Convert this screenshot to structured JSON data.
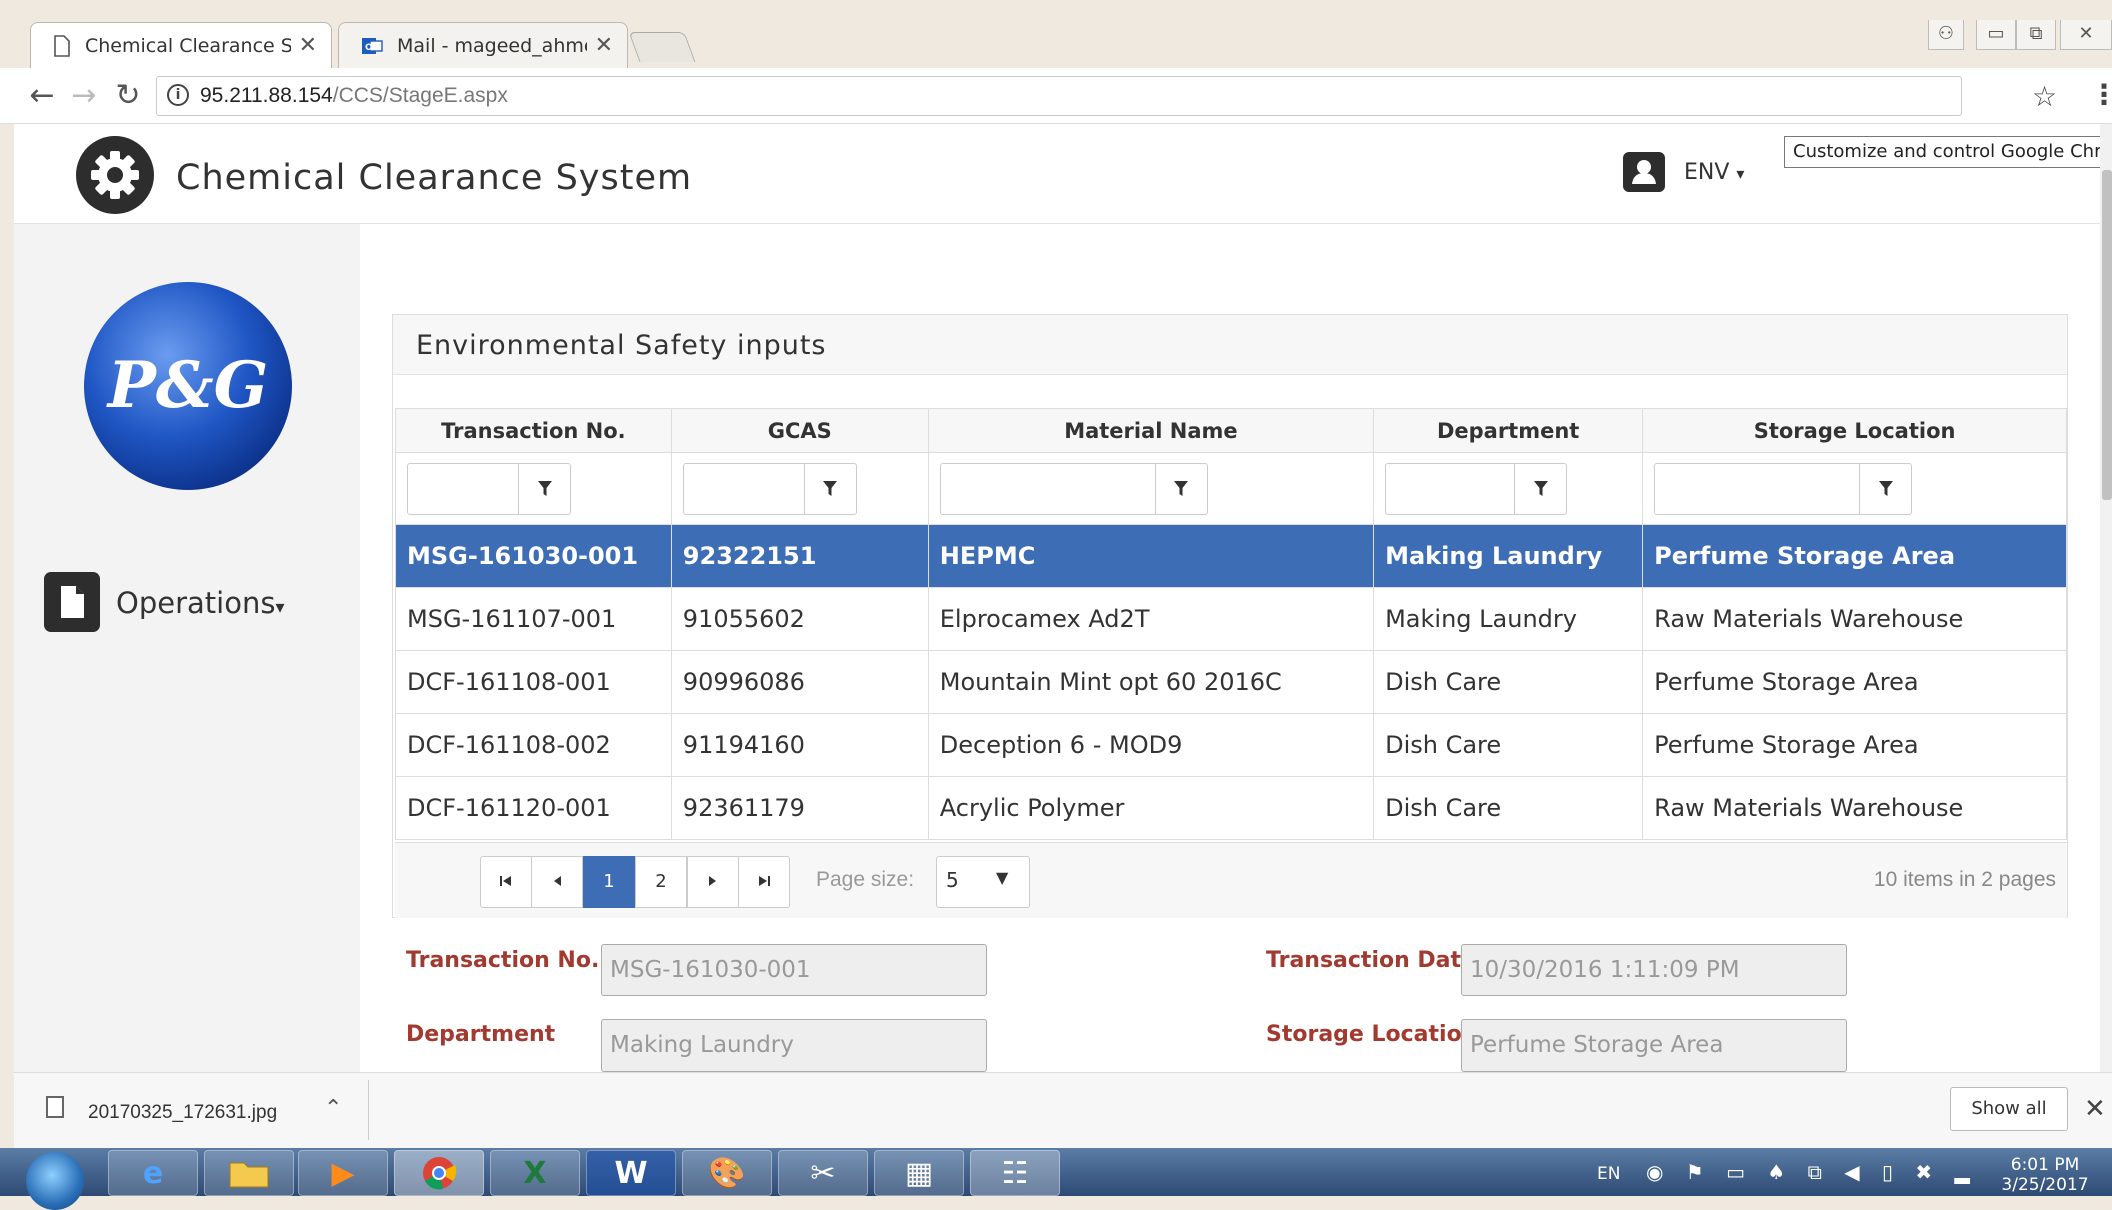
{
  "browser": {
    "tabs": [
      {
        "title": "Chemical Clearance Syst"
      },
      {
        "title": "Mail - mageed_ahmed@"
      }
    ],
    "url_host": "95.211.88.154",
    "url_path": "/CCS/StageE.aspx",
    "tooltip": "Customize and control Google Chrome"
  },
  "header": {
    "app_title": "Chemical Clearance System",
    "user_menu": "ENV",
    "caret": "▾"
  },
  "sidebar": {
    "logo_text": "P&G",
    "menu_label": "Operations"
  },
  "panel": {
    "title": "Environmental Safety inputs",
    "columns": [
      "Transaction No.",
      "GCAS",
      "Material Name",
      "Department",
      "Storage Location"
    ],
    "rows": [
      [
        "MSG-161030-001",
        "92322151",
        "HEPMC",
        "Making Laundry",
        "Perfume Storage Area"
      ],
      [
        "MSG-161107-001",
        "91055602",
        "Elprocamex Ad2T",
        "Making Laundry",
        "Raw Materials Warehouse"
      ],
      [
        "DCF-161108-001",
        "90996086",
        "Mountain Mint opt 60 2016C",
        "Dish Care",
        "Perfume Storage Area"
      ],
      [
        "DCF-161108-002",
        "91194160",
        "Deception 6 - MOD9",
        "Dish Care",
        "Perfume Storage Area"
      ],
      [
        "DCF-161120-001",
        "92361179",
        "Acrylic Polymer",
        "Dish Care",
        "Raw Materials Warehouse"
      ]
    ],
    "selected_row": 0,
    "pager": {
      "first": "⏮",
      "prev": "◀",
      "pages": [
        "1",
        "2"
      ],
      "current_page": "1",
      "next": "▶",
      "last": "⏭",
      "page_size_label": "Page size:",
      "page_size": "5",
      "info": "10 items in 2 pages"
    }
  },
  "form": {
    "transaction_no_label": "Transaction No.",
    "transaction_no_value": "MSG-161030-001",
    "transaction_date_label": "Transaction Date",
    "transaction_date_value": "10/30/2016 1:11:09 PM",
    "department_label": "Department",
    "department_value": "Making Laundry",
    "storage_location_label": "Storage Location",
    "storage_location_value": "Perfume Storage Area"
  },
  "downloads": {
    "file_name": "20170325_172631.jpg",
    "show_all": "Show all"
  },
  "taskbar": {
    "language": "EN",
    "time": "6:01 PM",
    "date": "3/25/2017"
  }
}
